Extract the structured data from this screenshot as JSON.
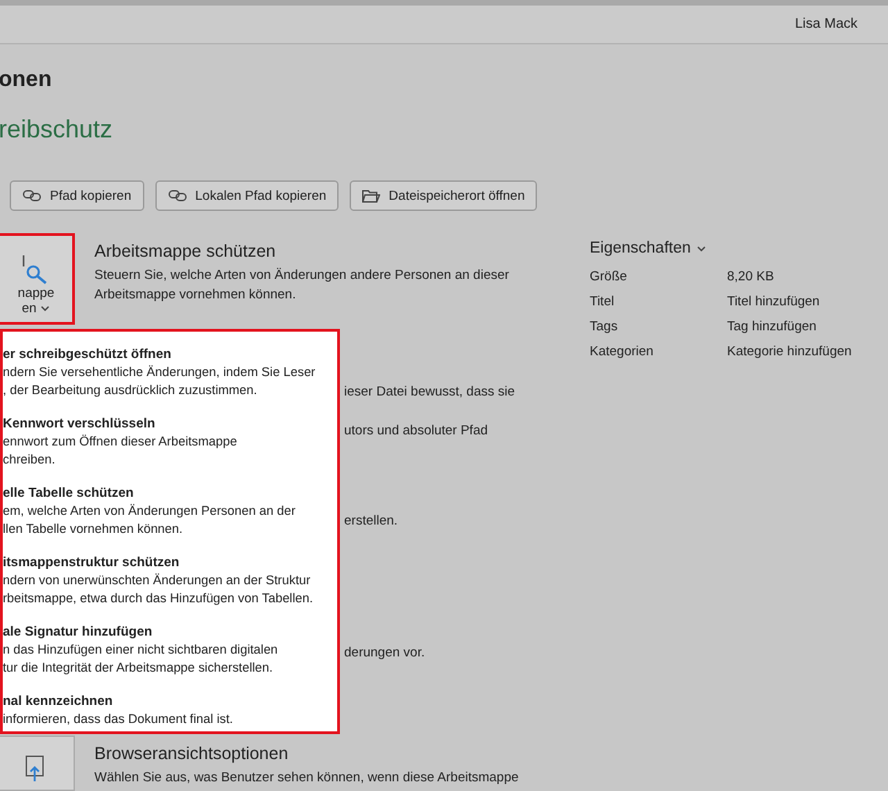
{
  "user": "Lisa Mack",
  "title": "onen",
  "subtitle": "reibschutz",
  "buttons": [
    {
      "label": "Pfad kopieren",
      "kind": "link"
    },
    {
      "label": "Lokalen Pfad kopieren",
      "kind": "link"
    },
    {
      "label": "Dateispeicherort öffnen",
      "kind": "folder"
    }
  ],
  "protect": {
    "button_lines": [
      "nappe",
      "en"
    ],
    "highlighted": true,
    "title": "Arbeitsmappe schützen",
    "description": [
      "Steuern Sie, welche Arten von Änderungen andere Personen an dieser",
      "Arbeitsmappe vornehmen können."
    ],
    "covered_fragments": [
      "ieser Datei bewusst, dass sie",
      "utors und absoluter Pfad",
      "erstellen.",
      "derungen vor."
    ]
  },
  "menu": {
    "highlighted": true,
    "items": [
      {
        "title": "er schreibgeschützt öffnen",
        "lines": [
          "ndern Sie versehentliche Änderungen, indem Sie Leser",
          ", der Bearbeitung ausdrücklich zuzustimmen."
        ]
      },
      {
        "title": "Kennwort verschlüsseln",
        "lines": [
          "ennwort zum Öffnen dieser Arbeitsmappe",
          "chreiben."
        ]
      },
      {
        "title": "elle Tabelle schützen",
        "lines": [
          "em, welche Arten von Änderungen Personen an der",
          "llen Tabelle vornehmen können."
        ]
      },
      {
        "title": "itsmappenstruktur schützen",
        "lines": [
          "ndern von unerwünschten Änderungen an der Struktur",
          "rbeitsmappe, etwa durch das Hinzufügen von Tabellen."
        ]
      },
      {
        "title": "ale Signatur hinzufügen",
        "lines": [
          "n das Hinzufügen einer nicht sichtbaren digitalen",
          "tur die Integrität der Arbeitsmappe sicherstellen."
        ]
      },
      {
        "title": "nal kennzeichnen",
        "lines": [
          "informieren, dass das Dokument final ist."
        ]
      }
    ]
  },
  "browser": {
    "title": "Browseransichtsoptionen",
    "description": "Wählen Sie aus, was Benutzer sehen können, wenn diese Arbeitsmappe"
  },
  "properties": {
    "header": "Eigenschaften",
    "rows": [
      {
        "label": "Größe",
        "value": "8,20 KB"
      },
      {
        "label": "Titel",
        "value": "Titel hinzufügen"
      },
      {
        "label": "Tags",
        "value": "Tag hinzufügen"
      },
      {
        "label": "Kategorien",
        "value": "Kategorie hinzufügen"
      }
    ]
  }
}
